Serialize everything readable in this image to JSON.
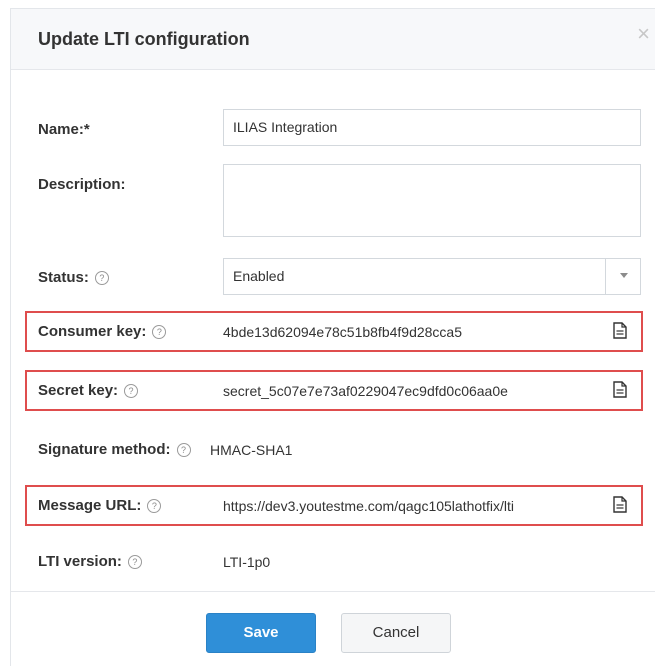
{
  "dialog": {
    "title": "Update LTI configuration",
    "close": "×"
  },
  "form": {
    "name": {
      "label": "Name:*",
      "value": "ILIAS Integration"
    },
    "description": {
      "label": "Description:",
      "value": ""
    },
    "status": {
      "label": "Status:",
      "value": "Enabled"
    },
    "consumer_key": {
      "label": "Consumer key:",
      "value": "4bde13d62094e78c51b8fb4f9d28cca5"
    },
    "secret_key": {
      "label": "Secret key:",
      "value": "secret_5c07e7e73af0229047ec9dfd0c06aa0e"
    },
    "signature_method": {
      "label": "Signature method:",
      "value": "HMAC-SHA1"
    },
    "message_url": {
      "label": "Message URL:",
      "value": "https://dev3.youtestme.com/qagc105lathotfix/lti"
    },
    "lti_version": {
      "label": "LTI version:",
      "value": "LTI-1p0"
    }
  },
  "icons": {
    "help": "?",
    "copy": "copy-icon",
    "close": "close-icon",
    "dropdown": "chevron-down-icon"
  },
  "buttons": {
    "save": "Save",
    "cancel": "Cancel"
  },
  "colors": {
    "accent": "#2f8fd8",
    "highlight": "#df4d4d"
  }
}
